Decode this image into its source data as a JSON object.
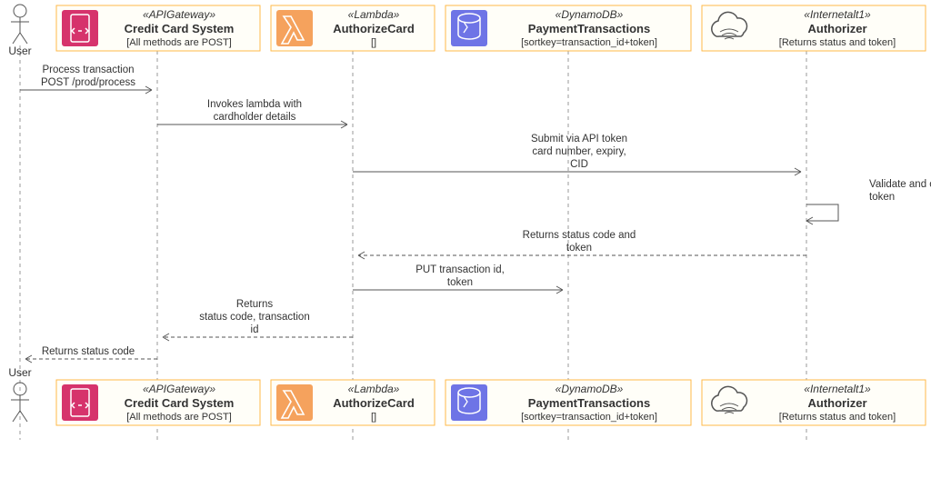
{
  "chart_data": {
    "type": "sequence-diagram",
    "participants": [
      {
        "id": "user",
        "name": "User",
        "kind": "actor"
      },
      {
        "id": "api",
        "stereotype": "«APIGateway»",
        "name": "Credit Card System",
        "sub": "[All methods are POST]"
      },
      {
        "id": "lambda",
        "stereotype": "«Lambda»",
        "name": "AuthorizeCard",
        "sub": "[]"
      },
      {
        "id": "db",
        "stereotype": "«DynamoDB»",
        "name": "PaymentTransactions",
        "sub": "[sortkey=transaction_id+token]"
      },
      {
        "id": "auth",
        "stereotype": "«Internetalt1»",
        "name": "Authorizer",
        "sub": "[Returns status and token]"
      }
    ],
    "messages": [
      {
        "from": "user",
        "to": "api",
        "l1": "Process transaction",
        "l2": "POST /prod/process"
      },
      {
        "from": "api",
        "to": "lambda",
        "l1": "Invokes lambda with",
        "l2": "cardholder details"
      },
      {
        "from": "lambda",
        "to": "auth",
        "l1": "Submit via API token",
        "l2": "card number, expiry,",
        "l3": "CID"
      },
      {
        "from": "auth",
        "to": "auth",
        "l1": "Validate and create",
        "l2": "token"
      },
      {
        "from": "auth",
        "to": "lambda",
        "l1": "Returns status code and",
        "l2": "token",
        "dashed": true
      },
      {
        "from": "lambda",
        "to": "db",
        "l1": "PUT transaction id,",
        "l2": "token"
      },
      {
        "from": "lambda",
        "to": "api",
        "l1": "Returns",
        "l2": "status code, transaction",
        "l3": "id",
        "dashed": true
      },
      {
        "from": "api",
        "to": "user",
        "l1": "Returns status code",
        "dashed": true
      }
    ]
  },
  "participants": {
    "user": {
      "name": "User"
    },
    "api": {
      "stereo": "«APIGateway»",
      "title": "Credit Card System",
      "sub": "[All methods are POST]"
    },
    "lambda": {
      "stereo": "«Lambda»",
      "title": "AuthorizeCard",
      "sub": "[]"
    },
    "db": {
      "stereo": "«DynamoDB»",
      "title": "PaymentTransactions",
      "sub": "[sortkey=transaction_id+token]"
    },
    "auth": {
      "stereo": "«Internetalt1»",
      "title": "Authorizer",
      "sub": "[Returns status and token]"
    }
  },
  "msg": {
    "m1a": "Process transaction",
    "m1b": "POST /prod/process",
    "m2a": "Invokes lambda with",
    "m2b": "cardholder details",
    "m3a": "Submit via API token",
    "m3b": "card number, expiry,",
    "m3c": "CID",
    "m4a": "Validate and create",
    "m4b": "token",
    "m5a": "Returns status code and",
    "m5b": "token",
    "m6a": "PUT transaction id,",
    "m6b": "token",
    "m7a": "Returns",
    "m7b": "status code, transaction",
    "m7c": "id",
    "m8a": "Returns status code"
  },
  "icon_colors": {
    "api": "#d6336c",
    "lambda": "#f5a25d",
    "db": "#6e74e6",
    "cloud": "#fffef8"
  }
}
